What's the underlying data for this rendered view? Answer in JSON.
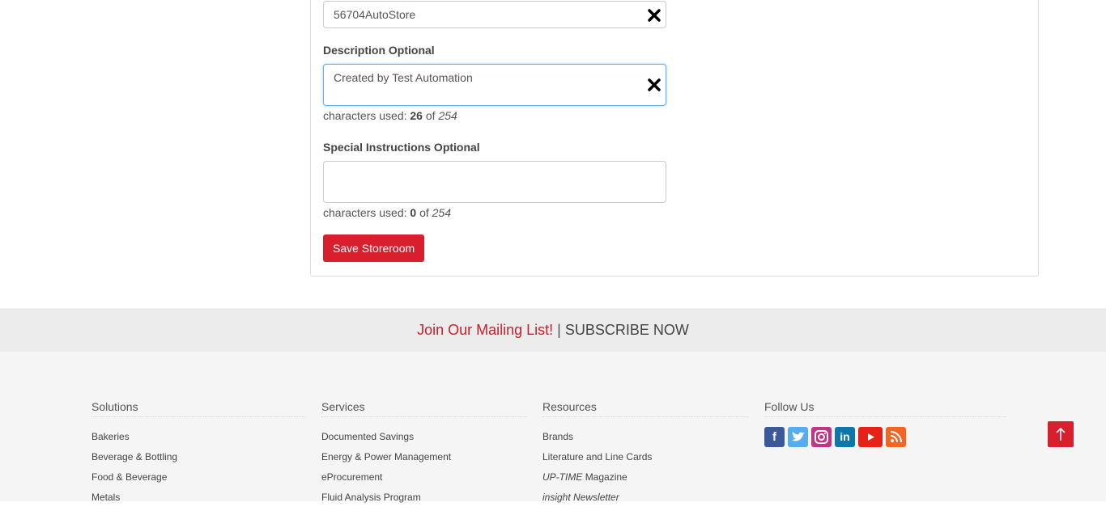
{
  "form": {
    "name_value": "56704AutoStore",
    "description_label": "Description Optional",
    "description_value": "Created by Test Automation",
    "description_counter": {
      "prefix": "characters used:",
      "used": "26",
      "of": "of",
      "max": "254"
    },
    "instructions_label": "Special Instructions Optional",
    "instructions_value": "",
    "instructions_counter": {
      "prefix": "characters used:",
      "used": "0",
      "of": "of",
      "max": "254"
    },
    "save_label": "Save Storeroom",
    "clear_icon": "close-icon"
  },
  "mailing": {
    "join": "Join Our Mailing List!",
    "separator": "|",
    "subscribe": "SUBSCRIBE NOW"
  },
  "footer": {
    "solutions": {
      "heading": "Solutions",
      "items": [
        "Bakeries",
        "Beverage & Bottling",
        "Food & Beverage",
        "Metals"
      ]
    },
    "services": {
      "heading": "Services",
      "items": [
        "Documented Savings",
        "Energy & Power Management",
        "eProcurement",
        "Fluid Analysis Program"
      ]
    },
    "resources": {
      "heading": "Resources",
      "items": [
        "Brands",
        "Literature and Line Cards",
        "Magazine",
        "Newsletter"
      ],
      "uptime": "UP-TIME",
      "insight": "insight"
    },
    "follow": {
      "heading": "Follow Us",
      "icons": [
        "facebook-icon",
        "twitter-icon",
        "instagram-icon",
        "linkedin-icon",
        "youtube-icon",
        "rss-icon"
      ]
    }
  },
  "colors": {
    "accent": "#d71f2d",
    "mailing_text": "#c8202d",
    "focus": "#66afe9"
  },
  "back_to_top_icon": "arrow-up-icon"
}
